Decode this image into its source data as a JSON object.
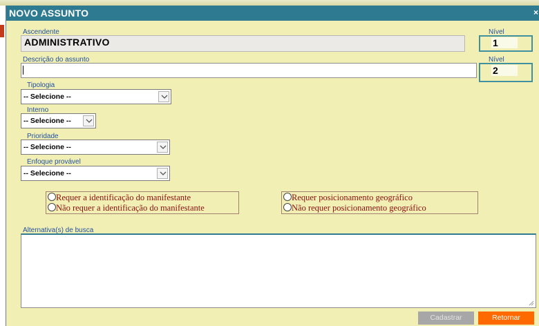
{
  "dialog": {
    "title": "NOVO ASSUNTO"
  },
  "ascendente": {
    "label": "Ascendente",
    "value": "ADMINISTRATIVO"
  },
  "nivel_1": {
    "label": "Nível",
    "value": "1"
  },
  "descricao": {
    "label": "Descrição do assunto",
    "value": ""
  },
  "nivel_2": {
    "label": "Nível",
    "value": "2"
  },
  "tipologia": {
    "label": "Tipologia",
    "selected": "-- Selecione --"
  },
  "interno": {
    "label": "Interno",
    "selected": "-- Selecione --"
  },
  "prioridade": {
    "label": "Prioridade",
    "selected": "-- Selecione --"
  },
  "enfoque": {
    "label": "Enfoque provável",
    "selected": "-- Selecione --"
  },
  "identificacao": {
    "options": [
      "Requer a identificação do manifestante",
      "Não requer a identificação do manifestante"
    ]
  },
  "geografico": {
    "options": [
      "Requer posicionamento geográfico",
      "Não requer posicionamento geográfico"
    ]
  },
  "alternativas": {
    "label": "Alternativa(s) de busca",
    "value": ""
  },
  "buttons": {
    "cadastrar": "Cadastrar",
    "retornar": "Retornar"
  },
  "colors": {
    "titlebar": "#2e7a90",
    "dialog_background": "#f2efb5",
    "label_text": "#1f4f9e",
    "radio_text": "#8a1010",
    "retornar_button": "#ff6a00",
    "cadastrar_button_disabled": "#a7a7a7"
  }
}
